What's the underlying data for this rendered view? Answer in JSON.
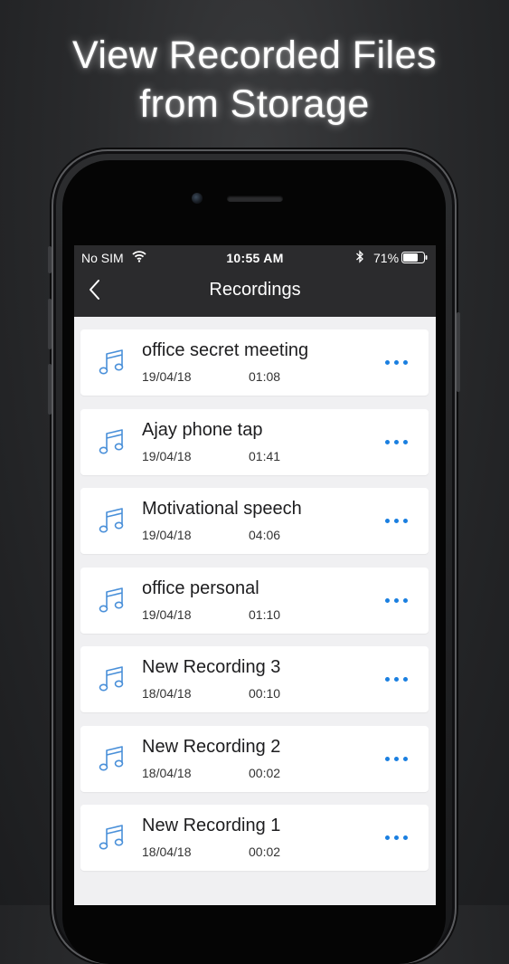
{
  "headline": {
    "line1": "View Recorded Files",
    "line2": "from Storage"
  },
  "status_bar": {
    "carrier": "No SIM",
    "time": "10:55 AM",
    "battery": "71%"
  },
  "nav": {
    "title": "Recordings"
  },
  "icons": {
    "back": "chevron-left-icon",
    "note": "music-note-icon",
    "more": "more-dots-icon",
    "wifi": "wifi-icon",
    "bluetooth": "bluetooth-icon",
    "battery": "battery-icon"
  },
  "colors": {
    "accent": "#1a7fe0",
    "nav_bg": "#2b2b2d",
    "list_bg": "#f0f0f2",
    "icon_blue": "#4a90d9"
  },
  "recordings": [
    {
      "title": "office secret meeting",
      "date": "19/04/18",
      "duration": "01:08"
    },
    {
      "title": "Ajay phone tap",
      "date": "19/04/18",
      "duration": "01:41"
    },
    {
      "title": "Motivational speech",
      "date": "19/04/18",
      "duration": "04:06"
    },
    {
      "title": "office personal",
      "date": "19/04/18",
      "duration": "01:10"
    },
    {
      "title": "New Recording 3",
      "date": "18/04/18",
      "duration": "00:10"
    },
    {
      "title": "New Recording 2",
      "date": "18/04/18",
      "duration": "00:02"
    },
    {
      "title": "New Recording 1",
      "date": "18/04/18",
      "duration": "00:02"
    }
  ]
}
